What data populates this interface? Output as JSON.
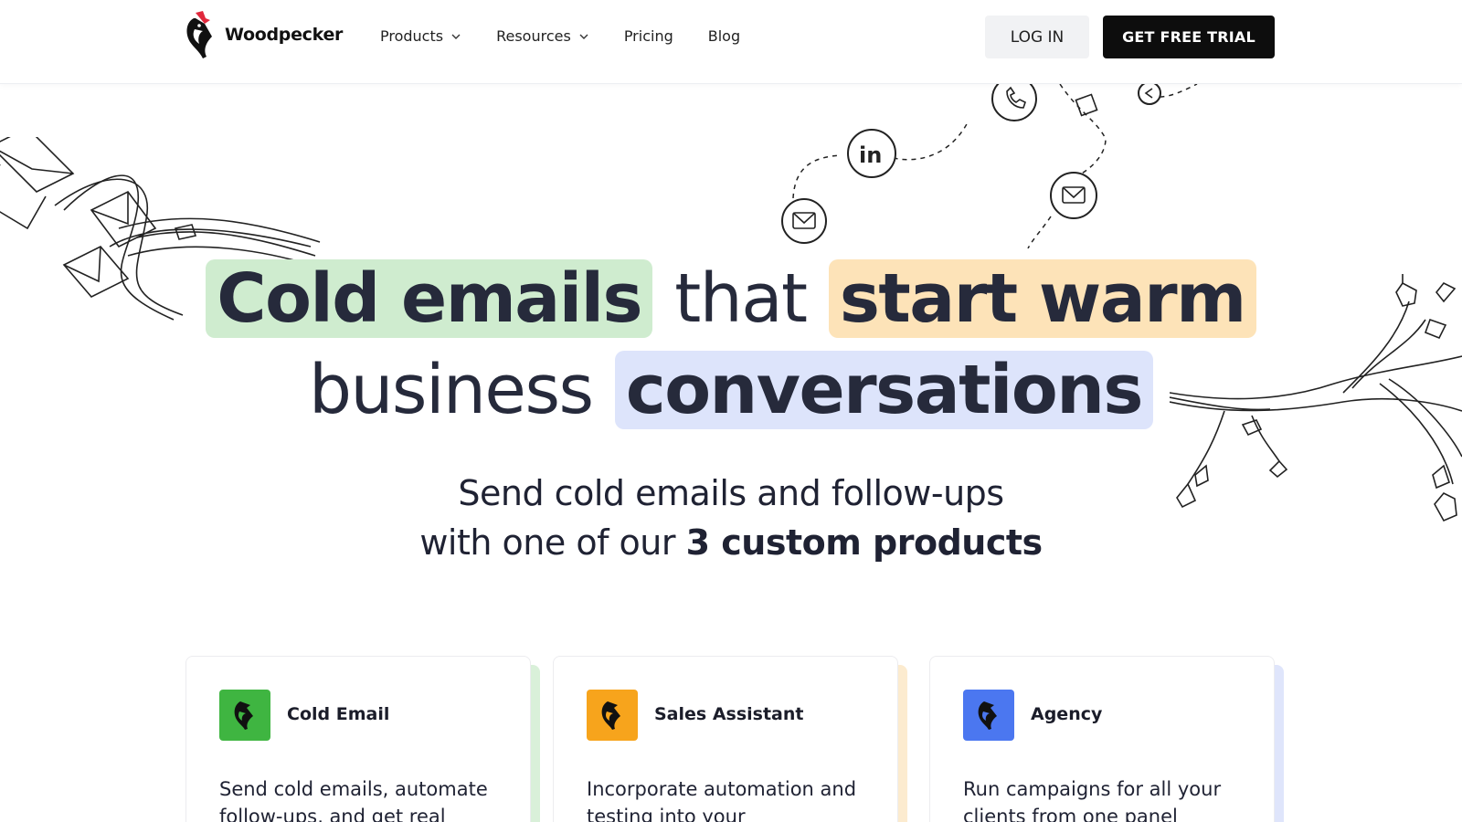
{
  "brand": {
    "name": "Woodpecker"
  },
  "nav": {
    "items": [
      {
        "label": "Products",
        "dropdown": true
      },
      {
        "label": "Resources",
        "dropdown": true
      },
      {
        "label": "Pricing",
        "dropdown": false
      },
      {
        "label": "Blog",
        "dropdown": false
      }
    ],
    "login_label": "LOG IN",
    "trial_label": "GET FREE TRIAL"
  },
  "hero": {
    "highlight1": "Cold emails",
    "connector": "that",
    "highlight2": "start warm",
    "line2_plain": "business",
    "highlight3": "conversations",
    "sub_line1": "Send cold emails and follow-ups",
    "sub_line2_plain": "with one of our",
    "sub_line2_bold": "3 custom products"
  },
  "cards": [
    {
      "title": "Cold Email",
      "description": "Send cold emails, automate follow-ups, and get real",
      "color": "#3fb541",
      "shadow": "#d9f0d9"
    },
    {
      "title": "Sales Assistant",
      "description": "Incorporate automation and testing into your",
      "color": "#f7a41c",
      "shadow": "#fcebcf"
    },
    {
      "title": "Agency",
      "description": "Run campaigns for all your clients from one panel",
      "color": "#4b77f0",
      "shadow": "#dfe5fb"
    }
  ],
  "colors": {
    "highlight_green": "#cfeccf",
    "highlight_orange": "#fde3b8",
    "highlight_blue": "#dde4fb",
    "brand_red": "#e0283c",
    "dark": "#0d0d0d"
  },
  "icons": [
    "woodpecker-logo-icon",
    "chevron-down-icon",
    "linkedin-icon",
    "phone-icon",
    "mail-icon",
    "reply-icon",
    "woodpecker-icon"
  ]
}
